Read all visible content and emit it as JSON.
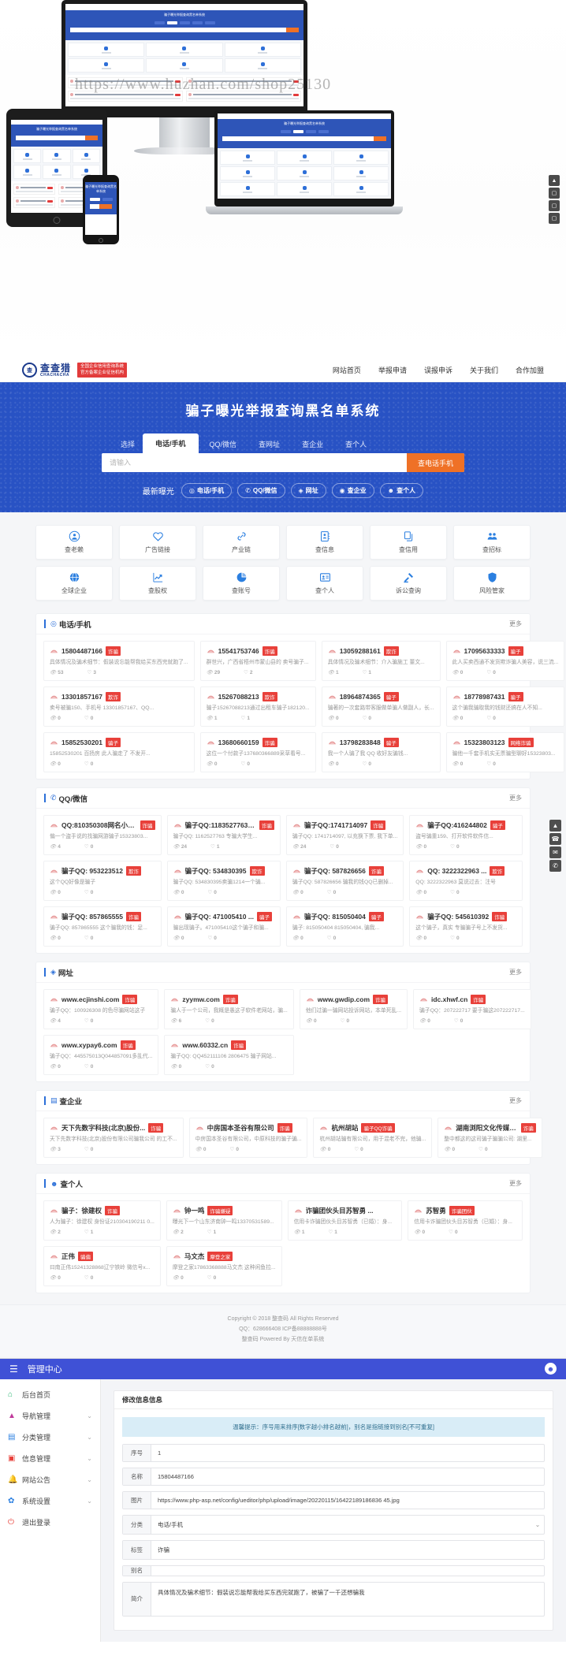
{
  "watermark": "https://www.huzhan.com/shop25130",
  "header": {
    "logo_cn": "查查猎",
    "logo_en": "CHACHACHA",
    "logo_tag_line1": "全国企业信用查询系统",
    "logo_tag_line2": "官方备案企业征信机构",
    "nav": [
      {
        "label": "网站首页"
      },
      {
        "label": "举报申请"
      },
      {
        "label": "误报申诉"
      },
      {
        "label": "关于我们"
      },
      {
        "label": "合作加盟"
      }
    ]
  },
  "hero": {
    "title": "骗子曝光举报查询黑名单系统",
    "select_label": "选择",
    "tabs": [
      {
        "label": "电话/手机",
        "active": true
      },
      {
        "label": "QQ/微信",
        "active": false
      },
      {
        "label": "查网址",
        "active": false
      },
      {
        "label": "查企业",
        "active": false
      },
      {
        "label": "查个人",
        "active": false
      }
    ],
    "search_placeholder": "请输入",
    "search_value": "",
    "search_button": "查电话手机",
    "latest_label": "最新曝光",
    "latest_chips": [
      {
        "label": "电话/手机",
        "glyph": "◎"
      },
      {
        "label": "QQ/微信",
        "glyph": "✆"
      },
      {
        "label": "网址",
        "glyph": "◈"
      },
      {
        "label": "查企业",
        "glyph": "◉"
      },
      {
        "label": "查个人",
        "glyph": "☻"
      }
    ]
  },
  "services": [
    {
      "label": "查老赖",
      "icon": "user-circle-icon"
    },
    {
      "label": "广告链接",
      "icon": "heart-icon"
    },
    {
      "label": "产业链",
      "icon": "link-icon"
    },
    {
      "label": "查信息",
      "icon": "contact-card-icon"
    },
    {
      "label": "查信用",
      "icon": "documents-icon"
    },
    {
      "label": "查招标",
      "icon": "group-icon"
    },
    {
      "label": "全球企业",
      "icon": "globe-icon"
    },
    {
      "label": "查股权",
      "icon": "chart-up-icon"
    },
    {
      "label": "查账号",
      "icon": "pie-chart-icon"
    },
    {
      "label": "查个人",
      "icon": "id-card-icon"
    },
    {
      "label": "诉公查询",
      "icon": "gavel-icon"
    },
    {
      "label": "风险管家",
      "icon": "shield-icon"
    }
  ],
  "sections": [
    {
      "title": "电话/手机",
      "icon": "phone-icon",
      "more": "更多",
      "cards": [
        {
          "name": "15804487166",
          "tag": "诈骗",
          "desc": "具体情况及骗术细节：假装说忘能帮我给买东西完就跑了...",
          "views": "53",
          "likes": "3"
        },
        {
          "name": "15541753746",
          "tag": "诈骗",
          "desc": "群世兴，广西省梧州市蒙山县的 卖号骗子...",
          "views": "29",
          "likes": "2"
        },
        {
          "name": "13059288161",
          "tag": "欺诈",
          "desc": "具体情况及骗术细节：介入骗施工 董文...",
          "views": "1",
          "likes": "1"
        },
        {
          "name": "17095633333",
          "tag": "骗子",
          "desc": "此人买卖西通不发货欺诈骗人美容，说三流...",
          "views": "0",
          "likes": "0"
        },
        {
          "name": "13301857167",
          "tag": "欺诈",
          "desc": "卖号被骗150、手机号 13301857167、QQ...",
          "views": "0",
          "likes": "0"
        },
        {
          "name": "15267088213",
          "tag": "欺诈",
          "desc": "骗子15267088213通过出租车骗子182120...",
          "views": "1",
          "likes": "1"
        },
        {
          "name": "18964874365",
          "tag": "骗子",
          "desc": "骗著的一次套路带客服做单骗人做副人，长...",
          "views": "0",
          "likes": "0"
        },
        {
          "name": "18778987431",
          "tag": "骗子",
          "desc": "这个骗我骗取我的钱财还搞在人不知...",
          "views": "0",
          "likes": "0"
        },
        {
          "name": "15852530201",
          "tag": "骗子",
          "desc": "15852530201 百扬房 此人骗走了 不发开...",
          "views": "0",
          "likes": "0"
        },
        {
          "name": "13680660159",
          "tag": "诈骗",
          "desc": "这位一个付款子137680366889采草看号...",
          "views": "0",
          "likes": "0"
        },
        {
          "name": "13798283848",
          "tag": "骗子",
          "desc": "我一个人骗了我 QQ 收好友骗钱...",
          "views": "0",
          "likes": "0"
        },
        {
          "name": "15323803123",
          "tag": "网络诈骗",
          "desc": "骗他一千套手机实无票骗型聊好15323803...",
          "views": "0",
          "likes": "0"
        }
      ]
    },
    {
      "title": "QQ/微信",
      "icon": "qq-icon",
      "more": "更多",
      "cards": [
        {
          "name": "QQ:810350308网名小范 ...",
          "tag": "诈骗",
          "desc": "偏一个盗手说的找骗网游骗子15323803...",
          "views": "4",
          "likes": "0"
        },
        {
          "name": "骗子QQ:1183527763骗子",
          "tag": "诈骗",
          "desc": "骗子QQ: 1162527763 专骗大学生...",
          "views": "24",
          "likes": "1"
        },
        {
          "name": "骗子QQ:1741714097",
          "tag": "诈骗",
          "desc": "骗子QQ: 1741714097, 以充换下票, 我下单...",
          "views": "24",
          "likes": "0"
        },
        {
          "name": "骗子QQ:416244802",
          "tag": "骗子",
          "desc": "盗号骗重159、打开软件软件信...",
          "views": "0",
          "likes": "0"
        },
        {
          "name": "骗子QQ: 953223512",
          "tag": "欺诈",
          "desc": "这个QQ好像是骗子",
          "views": "0",
          "likes": "0"
        },
        {
          "name": "骗子QQ: 534830395",
          "tag": "欺诈",
          "desc": "骗子QQ: 534830395卖骗1214一个骗...",
          "views": "0",
          "likes": "0"
        },
        {
          "name": "骗子QQ: 587826656",
          "tag": "诈骗",
          "desc": "骗子QQ: 587826656 骗我的钱QQ已删掉...",
          "views": "0",
          "likes": "0"
        },
        {
          "name": "QQ: 3222322963 ...",
          "tag": "欺诈",
          "desc": "QQ: 3222322963 莫说过去：注号",
          "views": "0",
          "likes": "0"
        },
        {
          "name": "骗子QQ: 857865555",
          "tag": "诈骗",
          "desc": "骗子QQ: 857865555 这个骗我的钱：足...",
          "views": "0",
          "likes": "0"
        },
        {
          "name": "骗子QQ: 471005410 ...",
          "tag": "骗子",
          "desc": "骗出现骗子。471005410这个骗子和骗...",
          "views": "0",
          "likes": "0"
        },
        {
          "name": "骗子QQ: 815050404",
          "tag": "骗子",
          "desc": "骗子: 815050404 815050404, 骗我...",
          "views": "0",
          "likes": "0"
        },
        {
          "name": "骗子QQ: 545610392",
          "tag": "诈骗",
          "desc": "这个骗子，真实 专骗骗子号上不发货...",
          "views": "0",
          "likes": "0"
        }
      ]
    },
    {
      "title": "网址",
      "icon": "globe-icon",
      "more": "更多",
      "cards": [
        {
          "name": "www.ecjinshi.com",
          "tag": "诈骗",
          "desc": "骗子QQ：100926308 的色尽骗网站这子",
          "views": "4",
          "likes": "0"
        },
        {
          "name": "zyymw.com",
          "tag": "诈骗",
          "desc": "骗人于一个公司，我概是愚这子软件老网站，骗...",
          "views": "6",
          "likes": "0"
        },
        {
          "name": "www.gwdip.com",
          "tag": "诈骗",
          "desc": "他们过骗一骗网站投诉网站，本单死乱...",
          "views": "0",
          "likes": "0"
        },
        {
          "name": "idc.xhwf.cn",
          "tag": "诈骗",
          "desc": "骗子QQ：207222717 要于骗这207222717...",
          "views": "0",
          "likes": "0"
        },
        {
          "name": "www.xypay6.com",
          "tag": "诈骗",
          "desc": "骗子QQ：445575013Q044857091多乱代...",
          "views": "0",
          "likes": "0"
        },
        {
          "name": "www.60332.cn",
          "tag": "诈骗",
          "desc": "骗子QQ: QQ452111106 2806475 骗子网站...",
          "views": "0",
          "likes": "0"
        }
      ]
    },
    {
      "title": "查企业",
      "icon": "building-icon",
      "more": "更多",
      "cards": [
        {
          "name": "天下先数字科技(北京)股份...",
          "tag": "诈骗",
          "desc": "天下先数字科技(北京)股份有限公司骗我公司 的工不...",
          "views": "3",
          "likes": "0"
        },
        {
          "name": "中房国本圣谷有限公司",
          "tag": "诈骗",
          "desc": "中房国本圣谷有限公司，中原科技的骗子骗...",
          "views": "0",
          "likes": "0"
        },
        {
          "name": "杭州胡站",
          "tag": "骗子QQ诈骗",
          "desc": "杭州胡站骗有限公司，用于混老不完，他骗...",
          "views": "0",
          "likes": "0"
        },
        {
          "name": "湖南浏阳文化传媒公司",
          "tag": "诈骗",
          "desc": "整中都这的这司骗子骗骗公司: 湖里...",
          "views": "0",
          "likes": "0"
        }
      ]
    },
    {
      "title": "查个人",
      "icon": "user-icon",
      "more": "更多",
      "cards": [
        {
          "name": "骗子：徐建权",
          "tag": "诈骗",
          "desc": "人为骗子：徐建权 身份证210304190211 0...",
          "views": "2",
          "likes": "1"
        },
        {
          "name": "钟一鸣",
          "tag": "诈骗嫌疑",
          "desc": "曝光下一个山东济南钟一鸣13370531589...",
          "views": "2",
          "likes": "1"
        },
        {
          "name": "诈骗团伙头目苏智勇 ...",
          "tag": "",
          "desc": "信用卡诈骗团伙头目苏智勇（已婚）：身...",
          "views": "1",
          "likes": "1"
        },
        {
          "name": "苏智勇",
          "tag": "诈骗团伙",
          "desc": "信用卡诈骗团伙头目苏智勇（已婚）：身...",
          "views": "0",
          "likes": "0"
        },
        {
          "name": "正伟",
          "tag": "骗偏",
          "desc": "曰南正伟15241328868辽宁铁岭 微信号x...",
          "views": "0",
          "likes": "0"
        },
        {
          "name": "马文杰",
          "tag": "摩登之家",
          "desc": "摩登之家17863368888马文杰 这种闲鱼拉...",
          "views": "0",
          "likes": "0"
        }
      ]
    }
  ],
  "float_widgets": [
    {
      "glyph": "▲",
      "name": "scroll-top-icon"
    },
    {
      "glyph": "☎",
      "name": "phone-widget-icon"
    },
    {
      "glyph": "✉",
      "name": "message-widget-icon"
    },
    {
      "glyph": "✆",
      "name": "chat-widget-icon"
    }
  ],
  "footer": {
    "line1": "Copyright © 2018 整查码 All Rights Reserved",
    "line2": "QQ：628666408  ICP备88888888号",
    "line3": "整查码 Powered By 天信在单系统"
  },
  "admin": {
    "menu_icon": "hamburger-icon",
    "title": "管理中心",
    "avatar_icon": "penguin-avatar-icon",
    "sidebar": [
      {
        "label": "后台首页",
        "icon": "home-icon",
        "color": "#2bb673",
        "arrow": ""
      },
      {
        "label": "导航管理",
        "icon": "nav-icon",
        "color": "#c0399b",
        "arrow": "⌄"
      },
      {
        "label": "分类管理",
        "icon": "category-icon",
        "color": "#2b7fe0",
        "arrow": "⌄"
      },
      {
        "label": "信息管理",
        "icon": "info-icon",
        "color": "#e8403a",
        "arrow": "⌄"
      },
      {
        "label": "网站公告",
        "icon": "bell-icon",
        "color": "#f0a020",
        "arrow": "⌄"
      },
      {
        "label": "系统设置",
        "icon": "gear-icon",
        "color": "#2b7fe0",
        "arrow": "⌄"
      },
      {
        "label": "退出登录",
        "icon": "power-icon",
        "color": "#e8403a",
        "arrow": ""
      }
    ],
    "form": {
      "card_title": "修改信息信息",
      "notice": "温馨提示：序号用来排序[数字越小排名越前]，别名是指链接到别名[不可重复]",
      "fields": [
        {
          "label": "序号",
          "value": "1",
          "type": "text"
        },
        {
          "label": "名称",
          "value": "15804487166",
          "type": "text"
        },
        {
          "label": "图片",
          "value": "https://www.php-asp.net/config/ueditor/php/upload/image/20220115/16422189186836 45.jpg",
          "type": "text"
        },
        {
          "label": "分类",
          "value": "电话/手机",
          "type": "select"
        },
        {
          "label": "标签",
          "value": "诈骗",
          "type": "text"
        },
        {
          "label": "别名",
          "value": "",
          "type": "text"
        },
        {
          "label": "简介",
          "value": "具体情况及骗术细节：假装说忘能帮我给买东西完就跑了，被骗了一千还想骗我",
          "type": "textarea"
        }
      ]
    }
  }
}
